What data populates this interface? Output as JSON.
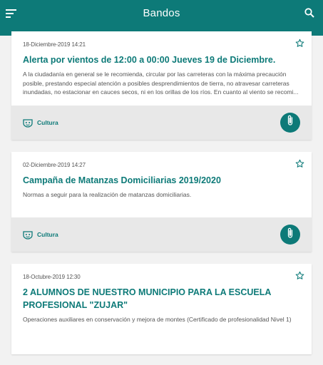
{
  "appbar": {
    "title": "Bandos",
    "menu_icon": "menu-icon",
    "search_icon": "search-icon"
  },
  "colors": {
    "brand": "#0d7a78",
    "background": "#f2f2f2",
    "footer": "#e8e8e8"
  },
  "cards": [
    {
      "date": "18-Diciembre-2019 14:21",
      "title": "Alerta por vientos de 12:00 a 00:00 Jueves 19 de Diciembre.",
      "excerpt": "A la ciudadanía en general se le recomienda, circular por las carreteras con la máxima precaución posible, prestando especial atención a posibles desprendimientos de tierra, no atravesar carreteras inundadas, no estacionar en cauces secos, ni en los orillas de los ríos. En cuanto al viento se recomi...",
      "category": "Cultura",
      "has_attachment": true
    },
    {
      "date": "02-Diciembre-2019 14:27",
      "title": "Campaña de Matanzas Domiciliarias 2019/2020",
      "excerpt": "Normas a seguir para la realización de matanzas domiciliarias.",
      "category": "Cultura",
      "has_attachment": true
    },
    {
      "date": "18-Octubre-2019 12:30",
      "title": "2 ALUMNOS DE NUESTRO MUNICIPIO PARA LA ESCUELA PROFESIONAL \"ZUJAR\"",
      "excerpt": "Operaciones auxiliares en conservación y mejora de montes (Certificado de profesionalidad Nivel 1)"
    }
  ]
}
